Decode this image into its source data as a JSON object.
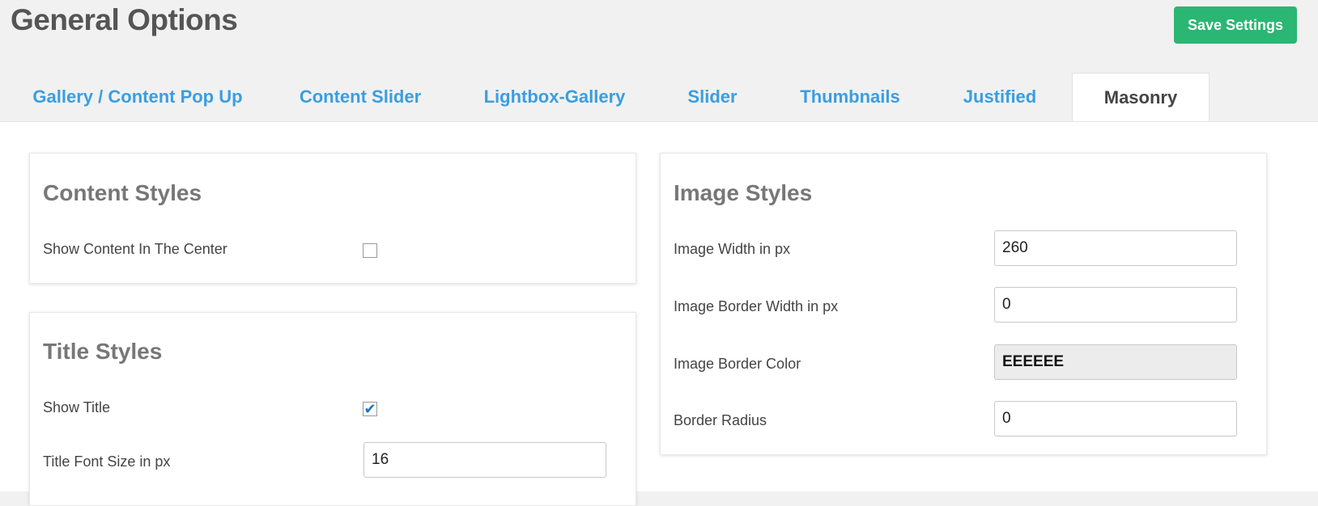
{
  "header": {
    "title": "General Options",
    "save_label": "Save Settings"
  },
  "tabs": [
    {
      "label": "Gallery / Content Pop Up",
      "active": false
    },
    {
      "label": "Content Slider",
      "active": false
    },
    {
      "label": "Lightbox-Gallery",
      "active": false
    },
    {
      "label": "Slider",
      "active": false
    },
    {
      "label": "Thumbnails",
      "active": false
    },
    {
      "label": "Justified",
      "active": false
    },
    {
      "label": "Masonry",
      "active": true
    }
  ],
  "content_styles": {
    "heading": "Content Styles",
    "show_center_label": "Show Content In The Center",
    "show_center_checked": false
  },
  "title_styles": {
    "heading": "Title Styles",
    "show_title_label": "Show Title",
    "show_title_checked": true,
    "font_size_label": "Title Font Size in px",
    "font_size_value": "16"
  },
  "image_styles": {
    "heading": "Image Styles",
    "width_label": "Image Width in px",
    "width_value": "260",
    "border_width_label": "Image Border Width in px",
    "border_width_value": "0",
    "border_color_label": "Image Border Color",
    "border_color_value": "EEEEEE",
    "border_radius_label": "Border Radius",
    "border_radius_value": "0"
  },
  "colors": {
    "accent": "#3a9ee0",
    "save_button": "#2bb673",
    "checkbox_check": "#1e73be"
  }
}
